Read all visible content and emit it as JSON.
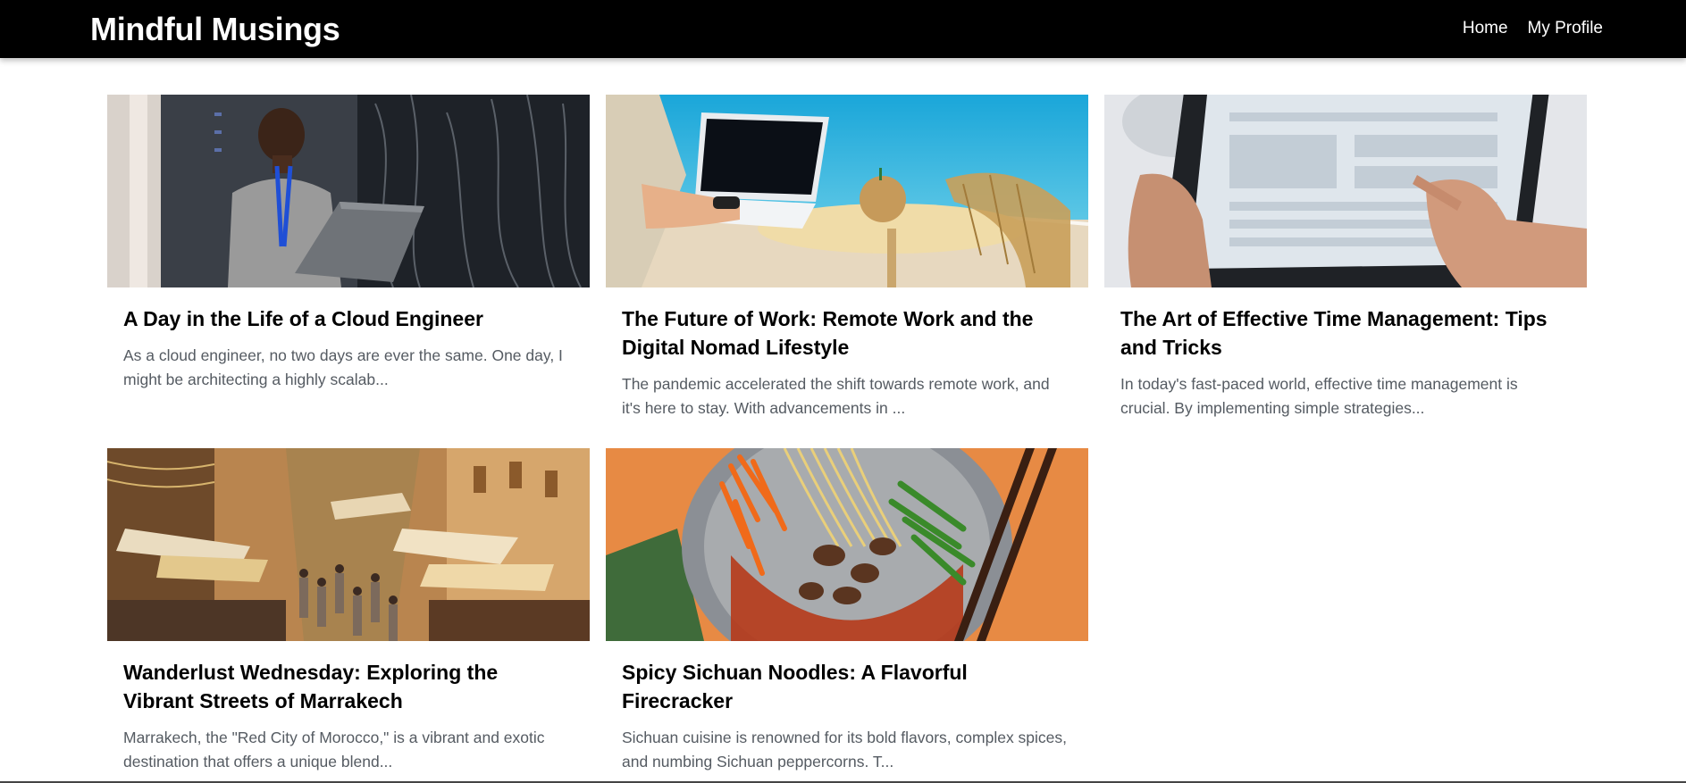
{
  "site": {
    "brand": "Mindful Musings",
    "nav": [
      {
        "label": "Home"
      },
      {
        "label": "My Profile"
      }
    ]
  },
  "posts": [
    {
      "title": "A Day in the Life of a Cloud Engineer",
      "excerpt": "As a cloud engineer, no two days are ever the same. One day, I might be architecting a highly scalab...",
      "image": "cloud-engineer-photo"
    },
    {
      "title": "The Future of Work: Remote Work and the Digital Nomad Lifestyle",
      "excerpt": "The pandemic accelerated the shift towards remote work, and it's here to stay. With advancements in ...",
      "image": "beach-laptop-photo"
    },
    {
      "title": "The Art of Effective Time Management: Tips and Tricks",
      "excerpt": "In today's fast-paced world, effective time management is crucial. By implementing simple strategies...",
      "image": "tablet-hands-photo"
    },
    {
      "title": "Wanderlust Wednesday: Exploring the Vibrant Streets of Marrakech",
      "excerpt": "Marrakech, the \"Red City of Morocco,\" is a vibrant and exotic destination that offers a unique blend...",
      "image": "marrakech-market-photo"
    },
    {
      "title": "Spicy Sichuan Noodles: A Flavorful Firecracker",
      "excerpt": "Sichuan cuisine is renowned for its bold flavors, complex spices, and numbing Sichuan peppercorns. T...",
      "image": "sichuan-noodles-photo"
    }
  ],
  "colors": {
    "navbar": "#000000",
    "excerpt_text": "#555b62",
    "title_text": "#000000"
  }
}
